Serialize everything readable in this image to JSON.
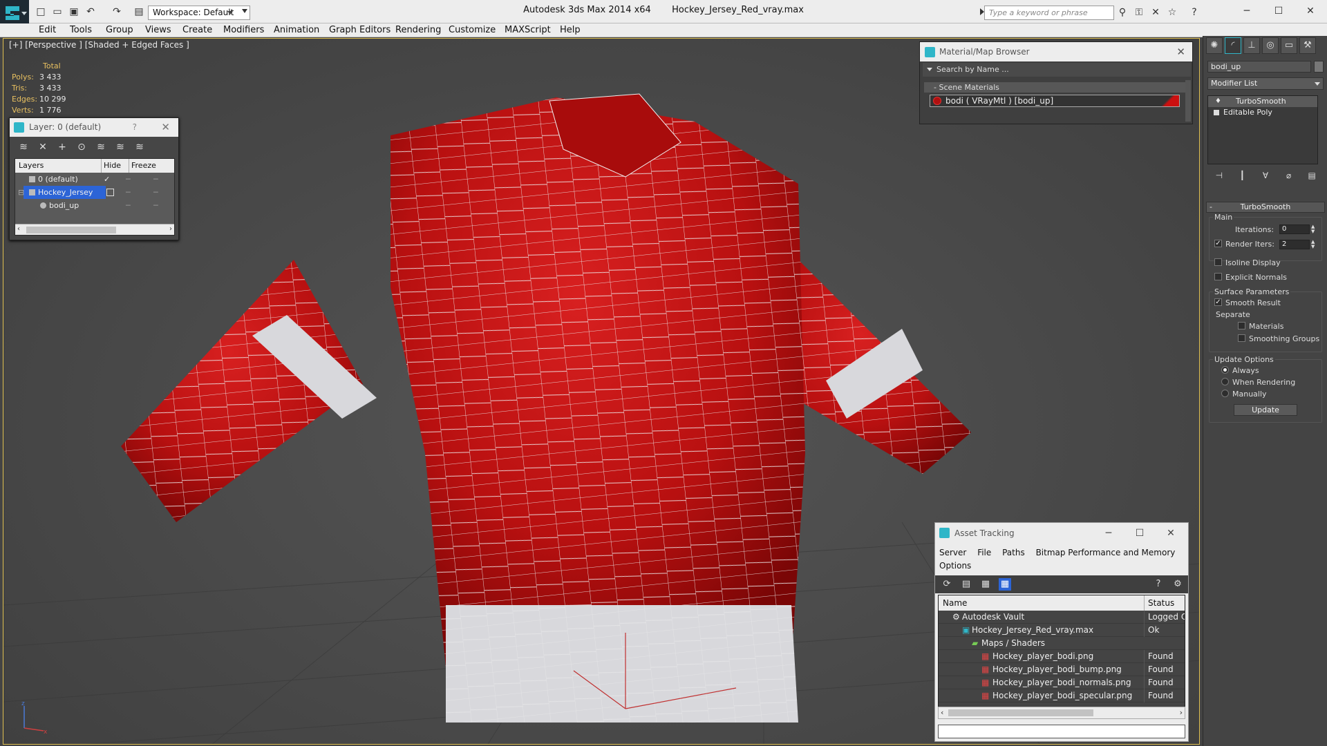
{
  "app": {
    "product": "Autodesk 3ds Max  2014 x64",
    "file": "Hockey_Jersey_Red_vray.max",
    "workspace": "Workspace: Default",
    "search_placeholder": "Type a keyword or phrase",
    "accent": "#2fb6c8"
  },
  "menu": [
    "Edit",
    "Tools",
    "Group",
    "Views",
    "Create",
    "Modifiers",
    "Animation",
    "Graph Editors",
    "Rendering",
    "Customize",
    "MAXScript",
    "Help"
  ],
  "viewport": {
    "label": "[+] [Perspective ] [Shaded + Edged Faces ]",
    "stats": {
      "header": "Total",
      "rows": [
        {
          "k": "Polys:",
          "v": "3 433"
        },
        {
          "k": "Tris:",
          "v": "3 433"
        },
        {
          "k": "Edges:",
          "v": "10 299"
        },
        {
          "k": "Verts:",
          "v": "1 776"
        }
      ]
    },
    "axis": {
      "x": "x",
      "z": "z"
    }
  },
  "layer_panel": {
    "title": "Layer: 0 (default)",
    "help": "?",
    "cols": {
      "layers": "Layers",
      "hide": "Hide",
      "freeze": "Freeze"
    },
    "rows": [
      {
        "name": "0 (default)"
      },
      {
        "name": "Hockey_Jersey"
      },
      {
        "name": "bodi_up"
      }
    ]
  },
  "material_browser": {
    "title": "Material/Map Browser",
    "search": "Search by Name ...",
    "section": "- Scene Materials",
    "material": "bodi  ( VRayMtl )  [bodi_up]",
    "swatch_color": "#cc1010"
  },
  "command_panel": {
    "object_name": "bodi_up",
    "modifier_list": "Modifier List",
    "stack": [
      "TurboSmooth",
      "Editable Poly"
    ],
    "rollout_title": "TurboSmooth",
    "main_label": "Main",
    "iterations_label": "Iterations:",
    "iterations": "0",
    "render_iters_label": "Render Iters:",
    "render_iters": "2",
    "isoline": "Isoline Display",
    "explicit_normals": "Explicit Normals",
    "surface_params": "Surface Parameters",
    "smooth_result": "Smooth Result",
    "separate": "Separate",
    "materials": "Materials",
    "smoothing_groups": "Smoothing Groups",
    "update_options": "Update Options",
    "always": "Always",
    "when_rendering": "When Rendering",
    "manually": "Manually",
    "update_button": "Update"
  },
  "asset_tracking": {
    "title": "Asset Tracking",
    "menu": [
      "Server",
      "File",
      "Paths",
      "Bitmap Performance and Memory",
      "Options"
    ],
    "cols": {
      "name": "Name",
      "status": "Status"
    },
    "rows": [
      {
        "name": "Autodesk Vault",
        "status": "Logged Ou"
      },
      {
        "name": "Hockey_Jersey_Red_vray.max",
        "status": "Ok"
      },
      {
        "name": "Maps / Shaders",
        "status": ""
      },
      {
        "name": "Hockey_player_bodi.png",
        "status": "Found"
      },
      {
        "name": "Hockey_player_bodi_bump.png",
        "status": "Found"
      },
      {
        "name": "Hockey_player_bodi_normals.png",
        "status": "Found"
      },
      {
        "name": "Hockey_player_bodi_specular.png",
        "status": "Found"
      }
    ]
  },
  "colors": {
    "jersey_red": "#c41414",
    "jersey_white": "#d8d8dc",
    "selection": "#2c64d6"
  }
}
